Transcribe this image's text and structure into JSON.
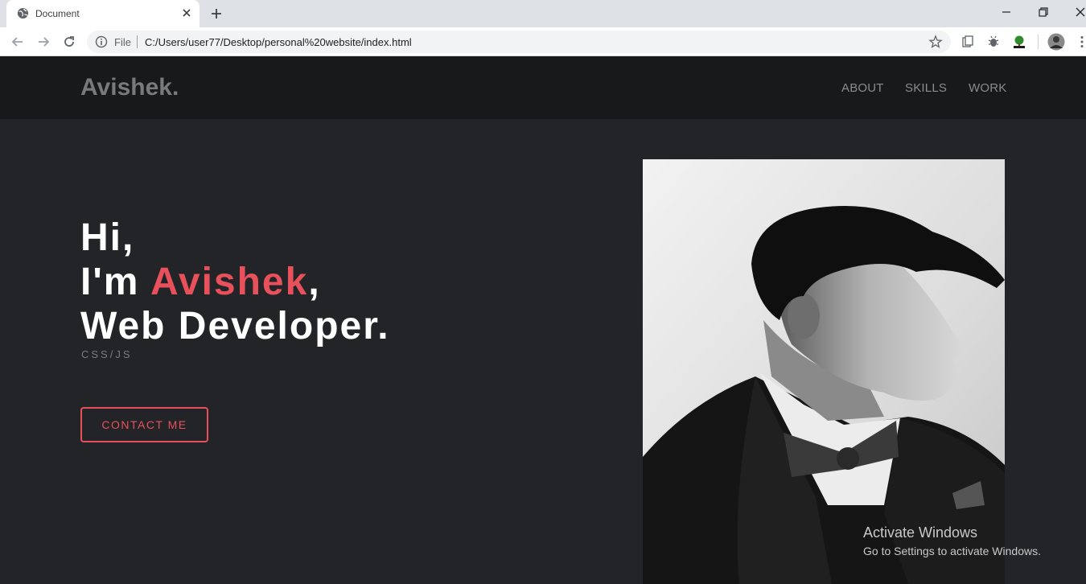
{
  "browser": {
    "tab_title": "Document",
    "url_scheme": "File",
    "url": "C:/Users/user77/Desktop/personal%20website/index.html",
    "icons": [
      "globe-icon",
      "close-icon",
      "plus-icon",
      "minimize-icon",
      "restore-icon",
      "close-window-icon",
      "back-icon",
      "forward-icon",
      "reload-icon",
      "info-icon",
      "star-icon",
      "extension-icon",
      "bug-icon",
      "tree-icon",
      "profile-avatar",
      "menu-icon"
    ]
  },
  "site": {
    "logo": "Avishek.",
    "nav": [
      "ABOUT",
      "SKILLS",
      "WORK"
    ]
  },
  "hero": {
    "line1": "Hi,",
    "line2_prefix": "I'm ",
    "name": "Avishek",
    "line2_suffix": ",",
    "line3": "Web Developer.",
    "subtitle": "CSS/JS",
    "cta": "CONTACT ME",
    "accent_color": "#e8505b"
  },
  "watermark": {
    "title": "Activate Windows",
    "subtitle": "Go to Settings to activate Windows."
  }
}
